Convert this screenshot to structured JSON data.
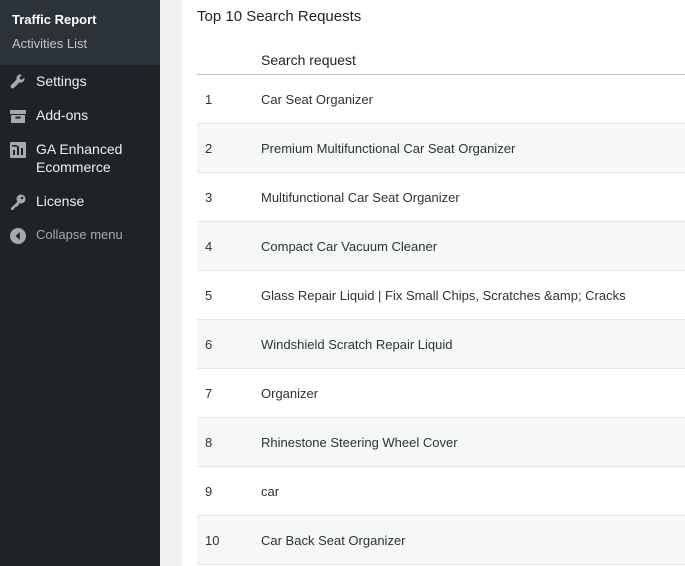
{
  "sidebar": {
    "submenu": [
      {
        "label": "Traffic Report",
        "current": true
      },
      {
        "label": "Activities List",
        "current": false
      }
    ],
    "menu": {
      "settings": "Settings",
      "addons": "Add-ons",
      "ga": "GA Enhanced Ecommerce",
      "license": "License",
      "collapse": "Collapse menu"
    }
  },
  "main": {
    "title": "Top 10 Search Requests",
    "table": {
      "headers": [
        "",
        "Search request"
      ],
      "rows": [
        {
          "num": "1",
          "request": "Car Seat Organizer"
        },
        {
          "num": "2",
          "request": "Premium Multifunctional Car Seat Organizer"
        },
        {
          "num": "3",
          "request": "Multifunctional Car Seat Organizer"
        },
        {
          "num": "4",
          "request": "Compact Car Vacuum Cleaner"
        },
        {
          "num": "5",
          "request": "Glass Repair Liquid | Fix Small Chips, Scratches &amp; Cracks"
        },
        {
          "num": "6",
          "request": "Windshield Scratch Repair Liquid"
        },
        {
          "num": "7",
          "request": "Organizer"
        },
        {
          "num": "8",
          "request": "Rhinestone Steering Wheel Cover"
        },
        {
          "num": "9",
          "request": "car"
        },
        {
          "num": "10",
          "request": "Car Back Seat Organizer"
        }
      ]
    }
  }
}
